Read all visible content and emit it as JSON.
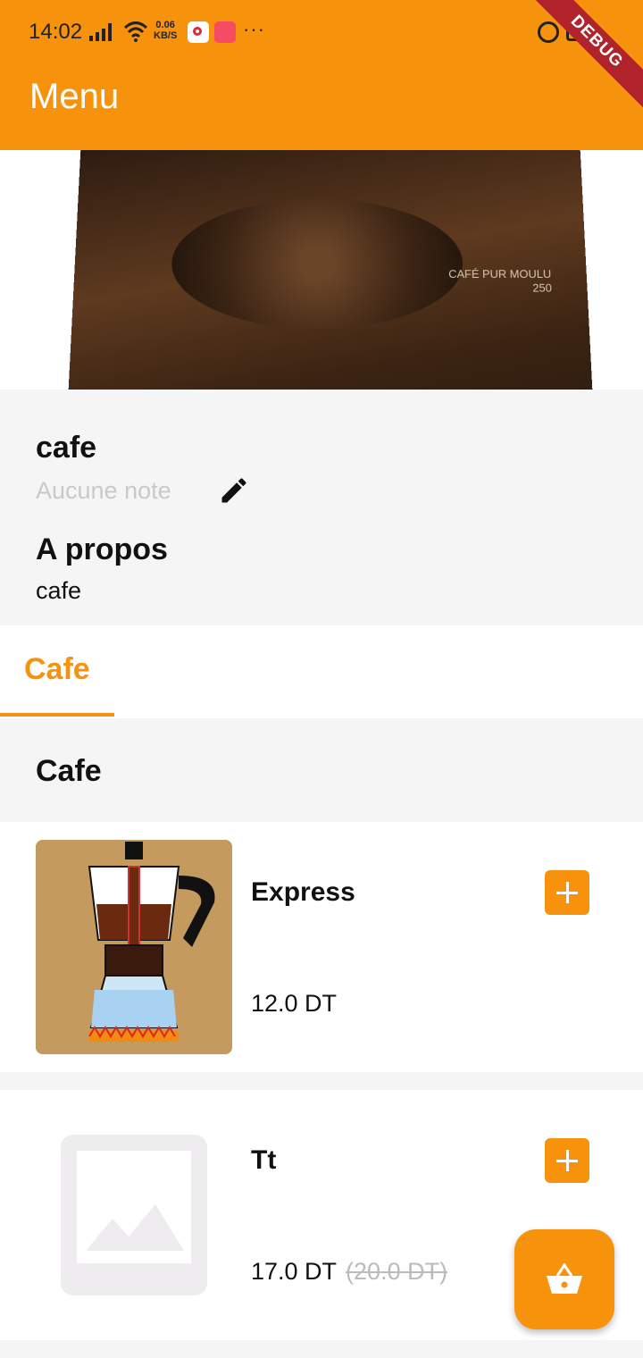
{
  "status_bar": {
    "time": "14:02",
    "speed_value": "0.06",
    "speed_unit": "KB/S",
    "more": "···"
  },
  "debug_banner": "DEBUG",
  "app_bar": {
    "title": "Menu"
  },
  "hero": {
    "package_text": "CAFÉ PUR MOULU",
    "package_weight": "250",
    "image_icon": "coffee-bag-photo"
  },
  "restaurant": {
    "name": "cafe",
    "note_placeholder": "Aucune note",
    "about_heading": "A propos",
    "about_text": "cafe"
  },
  "tabs": [
    {
      "label": "Cafe",
      "selected": true
    }
  ],
  "section": {
    "title": "Cafe"
  },
  "products": [
    {
      "name": "Express",
      "price": "12.0 DT",
      "old_price": "",
      "image": "moka-pot-diagram"
    },
    {
      "name": "Tt",
      "price": "17.0 DT",
      "old_price": "(20.0 DT)",
      "image": "placeholder-image-icon"
    }
  ],
  "colors": {
    "primary": "#F7920C",
    "panel": "#f5f5f5",
    "debug": "#b0232a"
  },
  "fab": {
    "icon": "basket-icon"
  }
}
